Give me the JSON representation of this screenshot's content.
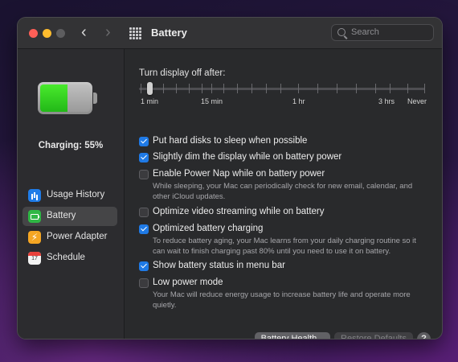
{
  "window": {
    "title": "Battery",
    "search_placeholder": "Search"
  },
  "battery": {
    "charge_label": "Charging: 55%",
    "charge_fraction": 0.55
  },
  "sidebar": {
    "items": [
      {
        "label": "Usage History",
        "icon": "bar-chart-icon",
        "selected": false
      },
      {
        "label": "Battery",
        "icon": "battery-icon",
        "selected": true
      },
      {
        "label": "Power Adapter",
        "icon": "lightning-icon",
        "selected": false
      },
      {
        "label": "Schedule",
        "icon": "calendar-icon",
        "selected": false,
        "icon_text": "17"
      }
    ]
  },
  "display_off": {
    "label": "Turn display off after:",
    "ticks": [
      "1 min",
      "15 min",
      "1 hr",
      "3 hrs",
      "Never"
    ],
    "value_label": "1 min"
  },
  "options": [
    {
      "label": "Put hard disks to sleep when possible",
      "checked": true,
      "description": ""
    },
    {
      "label": "Slightly dim the display while on battery power",
      "checked": true,
      "description": ""
    },
    {
      "label": "Enable Power Nap while on battery power",
      "checked": false,
      "description": "While sleeping, your Mac can periodically check for new email, calendar, and other iCloud updates."
    },
    {
      "label": "Optimize video streaming while on battery",
      "checked": false,
      "description": ""
    },
    {
      "label": "Optimized battery charging",
      "checked": true,
      "description": "To reduce battery aging, your Mac learns from your daily charging routine so it can wait to finish charging past 80% until you need to use it on battery."
    },
    {
      "label": "Show battery status in menu bar",
      "checked": true,
      "description": ""
    },
    {
      "label": "Low power mode",
      "checked": false,
      "description": "Your Mac will reduce energy usage to increase battery life and operate more quietly."
    }
  ],
  "buttons": {
    "battery_health": "Battery Health...",
    "restore_defaults": "Restore Defaults",
    "help": "?"
  },
  "colors": {
    "accent": "#1f7ae6",
    "battery_green": "#2fd11f"
  }
}
